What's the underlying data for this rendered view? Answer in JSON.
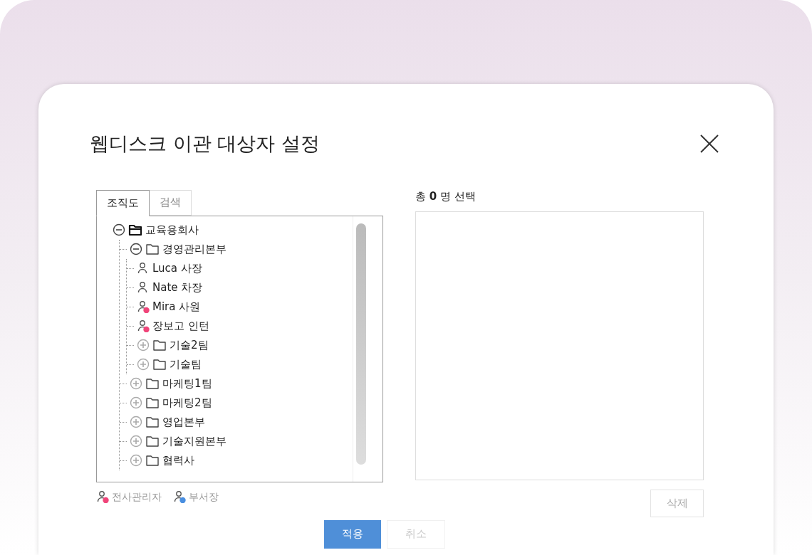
{
  "dialog": {
    "title": "웹디스크 이관 대상자 설정"
  },
  "tabs": [
    {
      "label": "조직도",
      "selected": true
    },
    {
      "label": "검색",
      "selected": false
    }
  ],
  "tree": [
    {
      "label": "교육용회사",
      "kind": "company",
      "expanded": true,
      "children": [
        {
          "label": "경영관리본부",
          "kind": "folder",
          "expanded": true,
          "children": [
            {
              "label": "Luca 사장",
              "kind": "person"
            },
            {
              "label": "Nate 차장",
              "kind": "person"
            },
            {
              "label": "Mira 사원",
              "kind": "person",
              "color": "#f0457a"
            },
            {
              "label": "장보고 인턴",
              "kind": "person",
              "color": "#f0457a"
            },
            {
              "label": "기술2팀",
              "kind": "folder",
              "expanded": false
            },
            {
              "label": "기술팀",
              "kind": "folder",
              "expanded": false
            }
          ]
        },
        {
          "label": "마케팅1팀",
          "kind": "folder",
          "expanded": false
        },
        {
          "label": "마케팅2팀",
          "kind": "folder",
          "expanded": false
        },
        {
          "label": "영업본부",
          "kind": "folder",
          "expanded": false
        },
        {
          "label": "기술지원본부",
          "kind": "folder",
          "expanded": false
        },
        {
          "label": "협력사",
          "kind": "folder",
          "expanded": false
        }
      ]
    }
  ],
  "legend": [
    {
      "label": "전사관리자",
      "color": "#f0457a"
    },
    {
      "label": "부서장",
      "color": "#4a8fe0"
    }
  ],
  "selection": {
    "prefix": "총",
    "count": "0",
    "suffix": "명 선택"
  },
  "delete_button": "삭제",
  "buttons": [
    {
      "label": "적용",
      "kind": "primary"
    },
    {
      "label": "취소",
      "kind": "secondary"
    }
  ]
}
